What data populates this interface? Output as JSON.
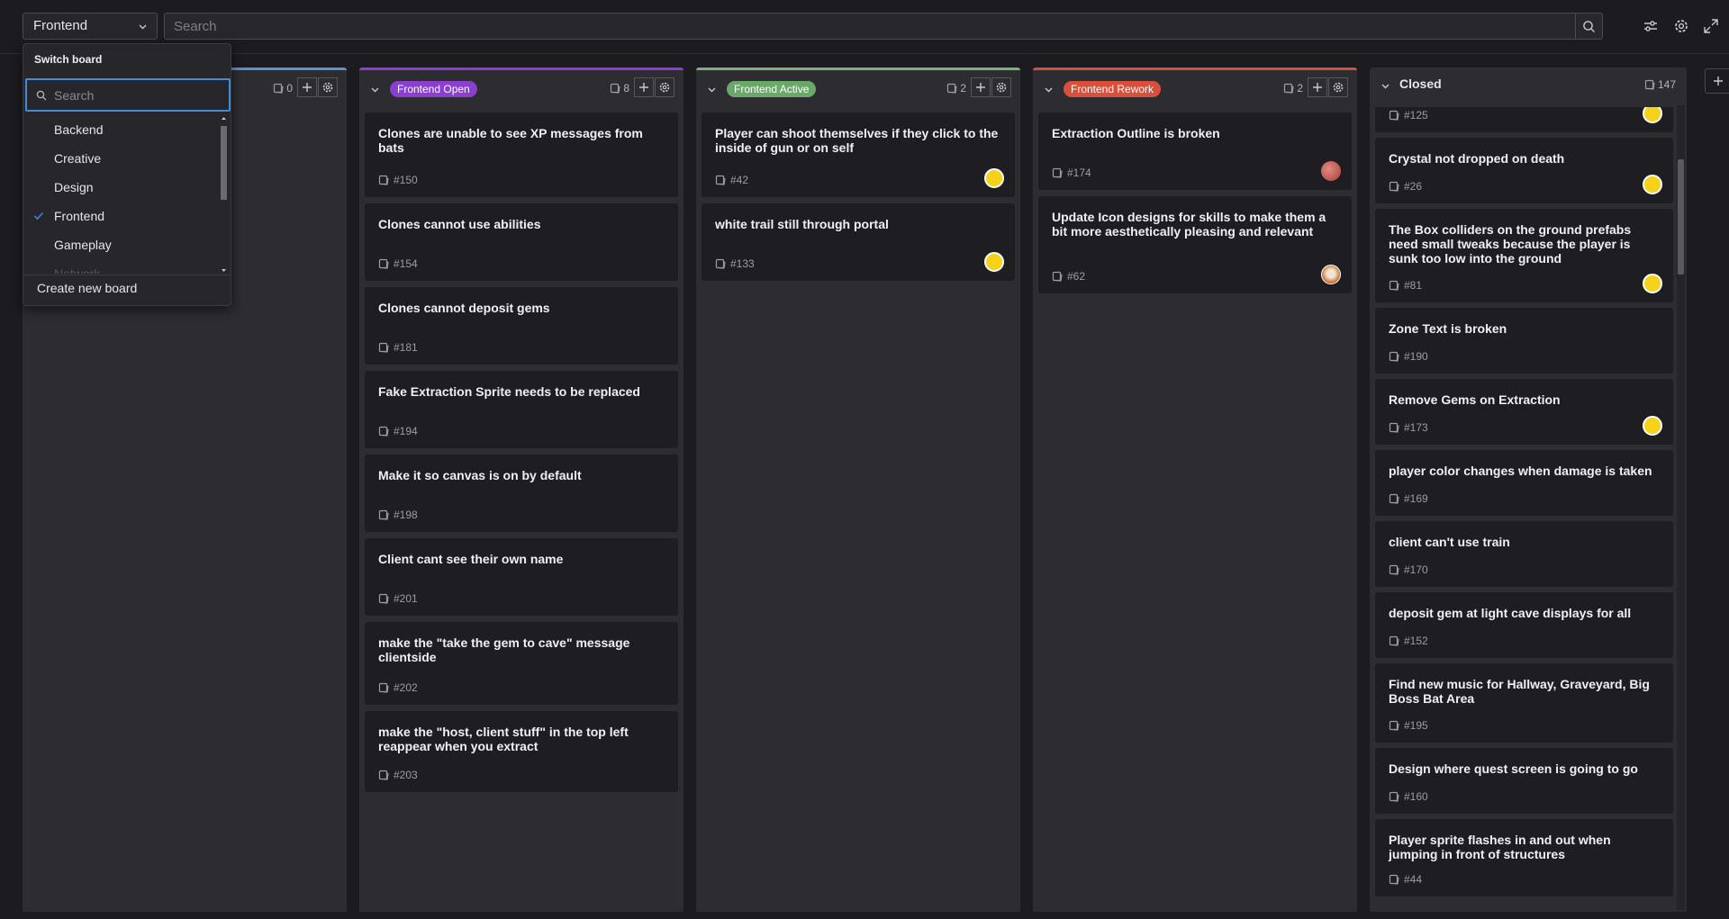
{
  "topbar": {
    "board_select_value": "Frontend",
    "search_placeholder": "Search"
  },
  "dropdown": {
    "title": "Switch board",
    "search_placeholder": "Search",
    "boards": [
      "Backend",
      "Creative",
      "Design",
      "Frontend",
      "Gameplay",
      "Network"
    ],
    "selected": "Frontend",
    "create_label": "Create new board"
  },
  "columns": [
    {
      "name": "",
      "count": "0",
      "accent": "#5b8fd6",
      "badge_color": "",
      "cards": []
    },
    {
      "name": "Frontend Open",
      "count": "8",
      "accent": "#8a3fd1",
      "badge_color": "#8a3fd1",
      "cards": [
        {
          "title": "Clones are unable to see XP messages from bats",
          "ref": "#150"
        },
        {
          "title": "Clones cannot use abilities",
          "ref": "#154"
        },
        {
          "title": "Clones cannot deposit gems",
          "ref": "#181"
        },
        {
          "title": "Fake Extraction Sprite needs to be replaced",
          "ref": "#194"
        },
        {
          "title": "Make it so canvas is on by default",
          "ref": "#198"
        },
        {
          "title": "Client cant see their own name",
          "ref": "#201"
        },
        {
          "title": "make the \"take the gem to cave\" message clientside",
          "ref": "#202"
        },
        {
          "title": "make the \"host, client stuff\" in the top left reappear when you extract",
          "ref": "#203"
        }
      ]
    },
    {
      "name": "Frontend Active",
      "count": "2",
      "accent": "#7bb07a",
      "badge_color": "#6aa86a",
      "cards": [
        {
          "title": "Player can shoot themselves if they click to the inside of gun or on self",
          "ref": "#42",
          "avatar": "yellow"
        },
        {
          "title": "white trail still through portal",
          "ref": "#133",
          "avatar": "yellow"
        }
      ]
    },
    {
      "name": "Frontend Rework",
      "count": "2",
      "accent": "#d8503c",
      "badge_color": "#d8503c",
      "cards": [
        {
          "title": "Extraction Outline is broken",
          "ref": "#174",
          "avatar": "red"
        },
        {
          "title": "Update Icon designs for skills to make them a bit more aesthetically pleasing and relevant",
          "ref": "#62",
          "avatar": "fox"
        }
      ]
    }
  ],
  "closed": {
    "name": "Closed",
    "count": "147",
    "cards": [
      {
        "title": "",
        "ref": "#125",
        "avatar": "yellow"
      },
      {
        "title": "Crystal not dropped on death",
        "ref": "#26",
        "avatar": "yellow"
      },
      {
        "title": "The Box colliders on the ground prefabs need small tweaks because the player is sunk too low into the ground",
        "ref": "#81",
        "avatar": "yellow"
      },
      {
        "title": "Zone Text is broken",
        "ref": "#190"
      },
      {
        "title": "Remove Gems on Extraction",
        "ref": "#173",
        "avatar": "yellow"
      },
      {
        "title": "player color changes when damage is taken",
        "ref": "#169"
      },
      {
        "title": "client can't use train",
        "ref": "#170"
      },
      {
        "title": "deposit gem at light cave displays for all",
        "ref": "#152"
      },
      {
        "title": "Find new music for Hallway, Graveyard, Big Boss Bat Area",
        "ref": "#195"
      },
      {
        "title": "Design where quest screen is going to go",
        "ref": "#160"
      },
      {
        "title": "Player sprite flashes in and out when jumping in front of structures",
        "ref": "#44"
      }
    ]
  },
  "icons": {
    "search": "search-icon",
    "filter": "filter-icon",
    "settings": "gear-icon",
    "expand": "expand-icon",
    "add": "plus-icon",
    "card": "card-icon",
    "check": "check-icon"
  }
}
